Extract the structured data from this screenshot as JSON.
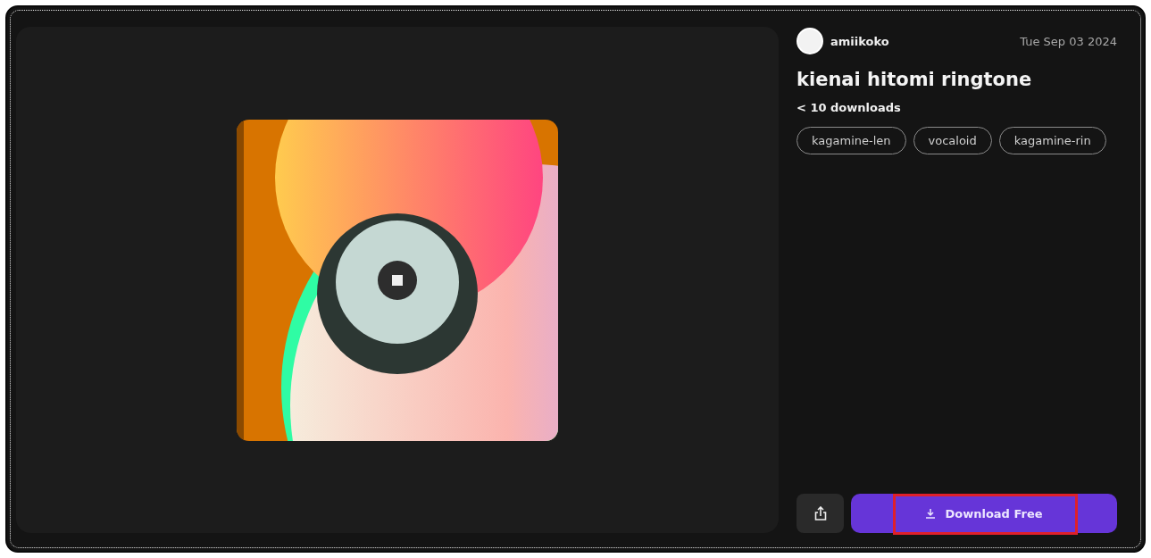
{
  "player": {
    "playing": true
  },
  "author": {
    "name": "amiikoko",
    "date": "Tue Sep 03 2024"
  },
  "title": "kienai hitomi ringtone",
  "downloads": "< 10 downloads",
  "tags": [
    {
      "label": "kagamine-len"
    },
    {
      "label": "vocaloid"
    },
    {
      "label": "kagamine-rin"
    }
  ],
  "actions": {
    "download": {
      "label": "Download Free",
      "highlighted": true
    }
  }
}
